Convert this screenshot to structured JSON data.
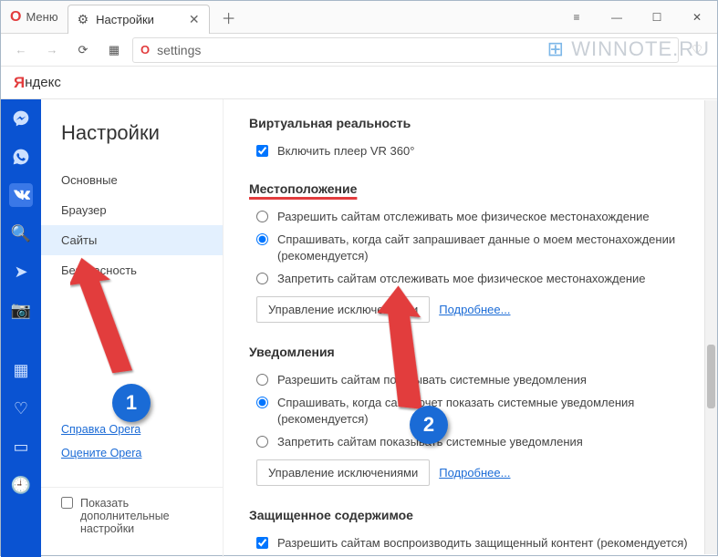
{
  "titlebar": {
    "menu_label": "Меню",
    "tab_title": "Настройки",
    "close_tab": "✕",
    "new_tab": "＋"
  },
  "navbar": {
    "address": "settings"
  },
  "yandex": {
    "ya_letter": "Я",
    "yandex_word": "ндекс"
  },
  "watermark": "WINNOTE.RU",
  "sidebar": {
    "heading": "Настройки",
    "items": [
      {
        "label": "Основные"
      },
      {
        "label": "Браузер"
      },
      {
        "label": "Сайты",
        "active": true
      },
      {
        "label": "Безопасность"
      }
    ],
    "links": {
      "help": "Справка Opera",
      "rate": "Оцените Opera"
    },
    "advanced_label": "Показать дополнительные настройки"
  },
  "content": {
    "vr": {
      "title": "Виртуальная реальность",
      "enable_vr": "Включить плеер VR 360°"
    },
    "location": {
      "title": "Местоположение",
      "allow": "Разрешить сайтам отслеживать мое физическое местонахождение",
      "ask": "Спрашивать, когда сайт запрашивает данные о моем местонахождении (рекомендуется)",
      "deny": "Запретить сайтам отслеживать мое физическое местонахождение",
      "manage": "Управление исключениями",
      "more": "Подробнее..."
    },
    "notifications": {
      "title": "Уведомления",
      "allow": "Разрешить сайтам показывать системные уведомления",
      "ask": "Спрашивать, когда сайт хочет показать системные уведомления (рекомендуется)",
      "deny": "Запретить сайтам показывать системные уведомления",
      "manage": "Управление исключениями",
      "more": "Подробнее..."
    },
    "protected": {
      "title": "Защищенное содержимое",
      "allow": "Разрешить сайтам воспроизводить защищенный контент (рекомендуется)"
    }
  },
  "annotations": {
    "n1": "1",
    "n2": "2"
  }
}
